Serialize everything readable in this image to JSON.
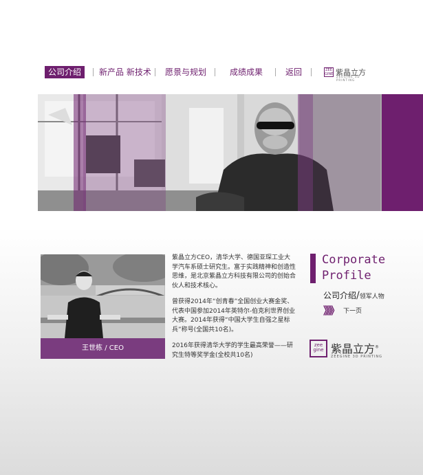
{
  "nav": {
    "items": [
      "公司介绍",
      "新产品 新技术",
      "愿景与规划",
      "成绩成果",
      "返回"
    ],
    "logo_name": "紫晶立方",
    "logo_sub": "ZEEGINE 3D PRINTING"
  },
  "colors": {
    "brand": "#6e1f6e",
    "caption_bg": "#7a3c7f"
  },
  "profile": {
    "caption": "王世栋 / CEO",
    "bio": [
      "紫晶立方CEO，清华大学、德国亚琛工业大学汽车系硕士研究生。富于实践精神和创造性思维，是北京紫晶立方科技有限公司的创始合伙人和技术核心。",
      "曾获得2014年“创青春”全国创业大赛金奖、代表中国参加2014年英特尔-伯克利世界创业大赛。2014年获得“中国大学生自强之星标兵”称号(全国共10名)。",
      "2016年获得清华大学的学生最高荣誉——研究生特等奖学金(全校共10名)"
    ]
  },
  "section": {
    "title_en_line1": "Corporate",
    "title_en_line2": "Profile",
    "title_cn": "公司介绍",
    "slash": "/",
    "subtitle": "领军人物",
    "next_arrow": "》》》",
    "next_label": "下一页"
  },
  "brand": {
    "logo_box": "zee\ngine",
    "logo_name": "紫晶立方",
    "logo_sup": "®",
    "logo_en": "ZEEGINE 3D PRINTING"
  }
}
